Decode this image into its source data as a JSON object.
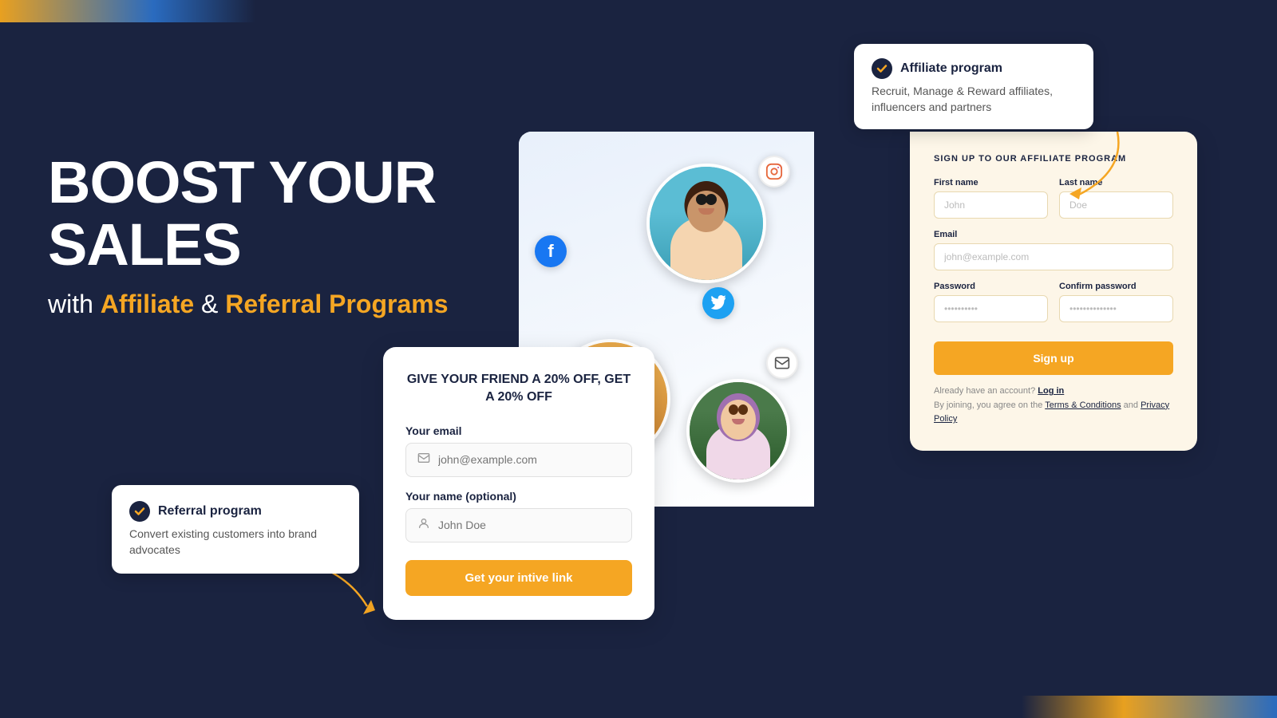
{
  "decorative": {
    "corner_top": "gradient bar top-left",
    "corner_bottom": "gradient bar bottom-right"
  },
  "hero": {
    "line1": "BOOST YOUR SALES",
    "subtitle_prefix": "with ",
    "subtitle_orange1": "Affiliate",
    "subtitle_middle": " & ",
    "subtitle_orange2": "Referral Programs"
  },
  "callout_left": {
    "title": "Referral program",
    "description": "Convert existing customers into brand advocates",
    "check_icon": "✓"
  },
  "callout_right": {
    "title": "Affiliate program",
    "description": "Recruit, Manage & Reward affiliates, influencers and partners",
    "check_icon": "✓"
  },
  "social_icons": {
    "instagram": "📷",
    "facebook": "f",
    "twitter": "🐦",
    "email": "✉"
  },
  "referral_form": {
    "headline": "GIVE YOUR FRIEND A 20% OFF, GET A 20% OFF",
    "email_label": "Your email",
    "email_placeholder": "john@example.com",
    "name_label": "Your name (optional)",
    "name_placeholder": "John Doe",
    "button_label": "Get your intive link"
  },
  "affiliate_form": {
    "title": "SIGN UP TO OUR AFFILIATE PROGRAM",
    "firstname_label": "First name",
    "firstname_placeholder": "John",
    "lastname_label": "Last name",
    "lastname_placeholder": "Doe",
    "email_label": "Email",
    "email_placeholder": "john@example.com",
    "password_label": "Password",
    "password_placeholder": "••••••••••",
    "confirm_password_label": "Confirm password",
    "confirm_password_placeholder": "••••••••••••••",
    "button_label": "Sign up",
    "already_text": "Already have an account?",
    "login_link": "Log in",
    "joining_text": "By joining, you agree on the",
    "terms_link": "Terms & Conditions",
    "and_text": "and",
    "privacy_link": "Privacy Policy"
  },
  "avatars": {
    "man_emoji": "👨🏿",
    "woman_emoji": "👩🏻",
    "woman2_emoji": "👩"
  }
}
